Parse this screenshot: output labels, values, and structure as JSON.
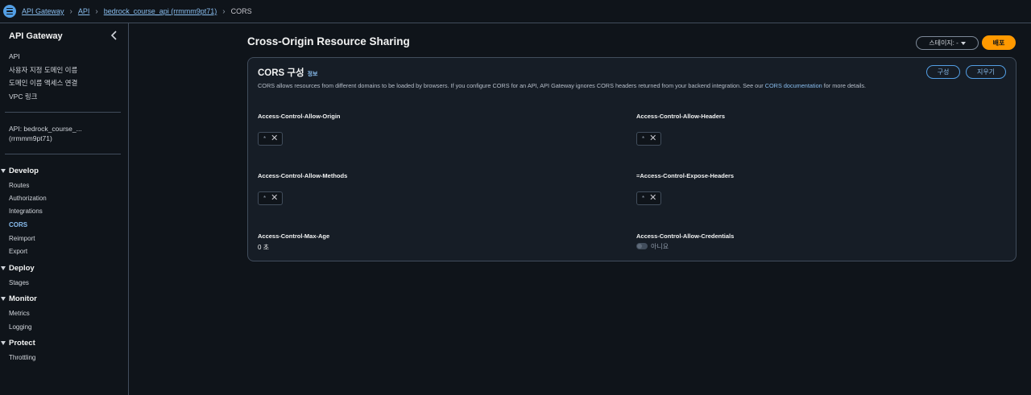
{
  "breadcrumb": {
    "items": [
      "API Gateway",
      "API",
      "bedrock_course_api (rrmmm9pt71)"
    ],
    "current": "CORS"
  },
  "sidebar": {
    "title": "API Gateway",
    "links": [
      "API",
      "사용자 지정 도메인 이름",
      "도메인 이름 액세스 연결",
      "VPC 링크"
    ],
    "api_name_line1": "API: bedrock_course_...",
    "api_name_line2": "(rrmmm9pt71)",
    "sections": [
      {
        "label": "Develop",
        "items": [
          "Routes",
          "Authorization",
          "Integrations",
          "CORS",
          "Reimport",
          "Export"
        ]
      },
      {
        "label": "Deploy",
        "items": [
          "Stages"
        ]
      },
      {
        "label": "Monitor",
        "items": [
          "Metrics",
          "Logging"
        ]
      },
      {
        "label": "Protect",
        "items": [
          "Throttling"
        ]
      }
    ],
    "active_item": "CORS"
  },
  "header": {
    "title": "Cross-Origin Resource Sharing",
    "stage_select": "스테이지: -",
    "deploy_label": "배포"
  },
  "panel": {
    "title": "CORS 구성",
    "info_label": "정보",
    "description_before": "CORS allows resources from different domains to be loaded by browsers. If you configure CORS for an API, API Gateway ignores CORS headers returned from your backend integration. See our ",
    "description_link": "CORS documentation",
    "description_after": " for more details.",
    "configure_label": "구성",
    "clear_label": "지우기",
    "fields": {
      "allow_origin": {
        "label": "Access-Control-Allow-Origin",
        "token": "*"
      },
      "allow_headers": {
        "label": "Access-Control-Allow-Headers",
        "token": "*"
      },
      "allow_methods": {
        "label": "Access-Control-Allow-Methods",
        "token": "*"
      },
      "expose_headers": {
        "label": "=Access-Control-Expose-Headers",
        "token": "*"
      },
      "max_age": {
        "label": "Access-Control-Max-Age",
        "value": "0 초"
      },
      "allow_credentials": {
        "label": "Access-Control-Allow-Credentials",
        "value": "아니요"
      }
    }
  },
  "colors": {
    "background": "#0f141a",
    "panel": "#161d26",
    "link": "#89bdee",
    "accent": "#ff9900",
    "border": "#414d5c"
  },
  "icons": [
    "hamburger-menu-icon",
    "chevron-right-icon",
    "chevron-left-icon",
    "caret-down-icon",
    "close-icon",
    "toggle-switch-icon"
  ]
}
